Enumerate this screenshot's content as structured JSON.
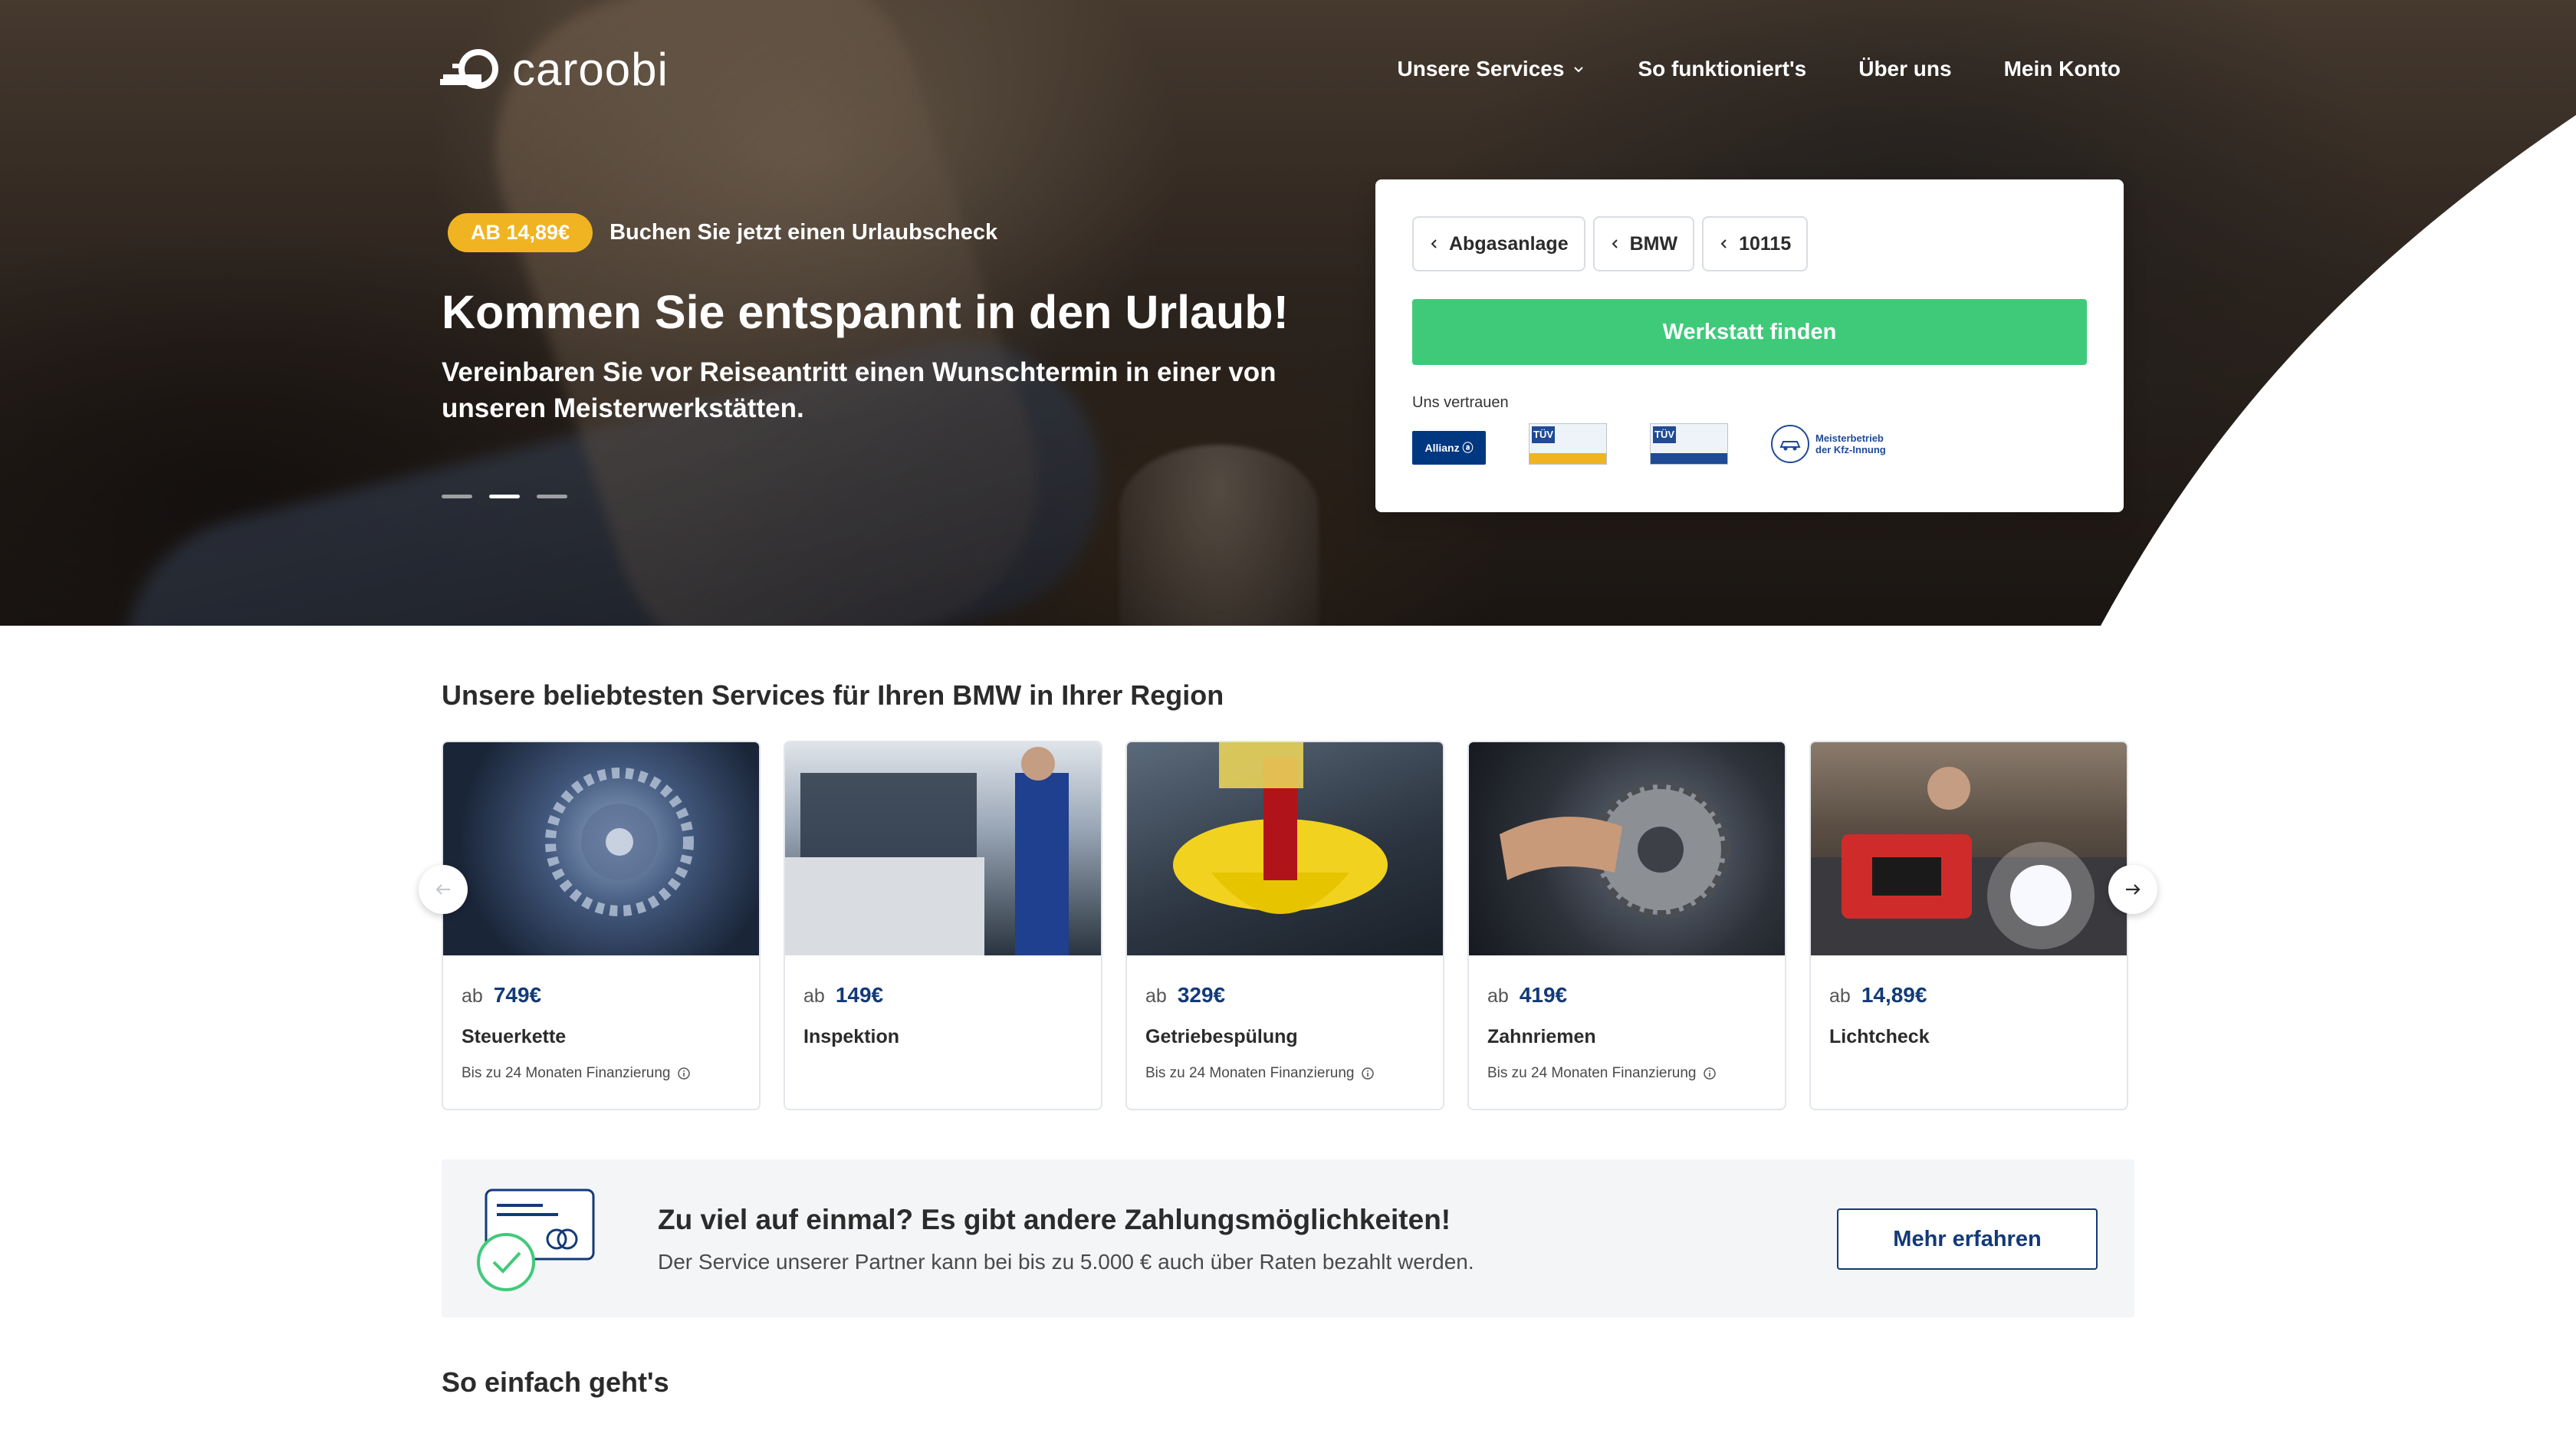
{
  "header": {
    "logo_text": "caroobi",
    "nav": [
      {
        "label": "Unsere Services",
        "has_dropdown": true
      },
      {
        "label": "So funktioniert's"
      },
      {
        "label": "Über uns"
      },
      {
        "label": "Mein Konto"
      }
    ]
  },
  "hero": {
    "badge": "AB 14,89€",
    "promo_text": "Buchen Sie jetzt einen Urlaubscheck",
    "title": "Kommen Sie entspannt in den Urlaub!",
    "subtitle": "Vereinbaren Sie vor Reiseantritt einen Wunschtermin in einer von unseren Meisterwerkstätten.",
    "slides_total": 3,
    "active_slide": 2
  },
  "search": {
    "chips": [
      "Abgasanlage",
      "BMW",
      "10115"
    ],
    "button": "Werkstatt finden",
    "trust_label": "Uns vertrauen",
    "trust_logos": [
      "Allianz",
      "TÜV",
      "TÜV",
      "Meisterbetrieb der Kfz-Innung"
    ],
    "allianz_text": "Allianz ⓐ",
    "tuv_text": "TÜV",
    "meister_text": "Meisterbetrieb der Kfz-Innung"
  },
  "services": {
    "title": "Unsere beliebtesten Services für Ihren BMW in Ihrer Region",
    "price_prefix": "ab",
    "cards": [
      {
        "price": "749€",
        "name": "Steuerkette",
        "finance": "Bis zu 24 Monaten Finanzierung"
      },
      {
        "price": "149€",
        "name": "Inspektion",
        "finance": ""
      },
      {
        "price": "329€",
        "name": "Getriebespülung",
        "finance": "Bis zu 24 Monaten Finanzierung"
      },
      {
        "price": "419€",
        "name": "Zahnriemen",
        "finance": "Bis zu 24 Monaten Finanzierung"
      },
      {
        "price": "14,89€",
        "name": "Lichtcheck",
        "finance": ""
      }
    ]
  },
  "payment": {
    "title": "Zu viel auf einmal? Es gibt andere Zahlungsmöglichkeiten!",
    "subtitle": "Der Service unserer Partner kann bei bis zu 5.000 € auch über Raten bezahlt werden.",
    "button": "Mehr erfahren"
  },
  "how_it_works": {
    "title": "So einfach geht's"
  },
  "colors": {
    "accent_green": "#3fca7a",
    "badge_yellow": "#f0b322",
    "brand_blue": "#123a78"
  }
}
